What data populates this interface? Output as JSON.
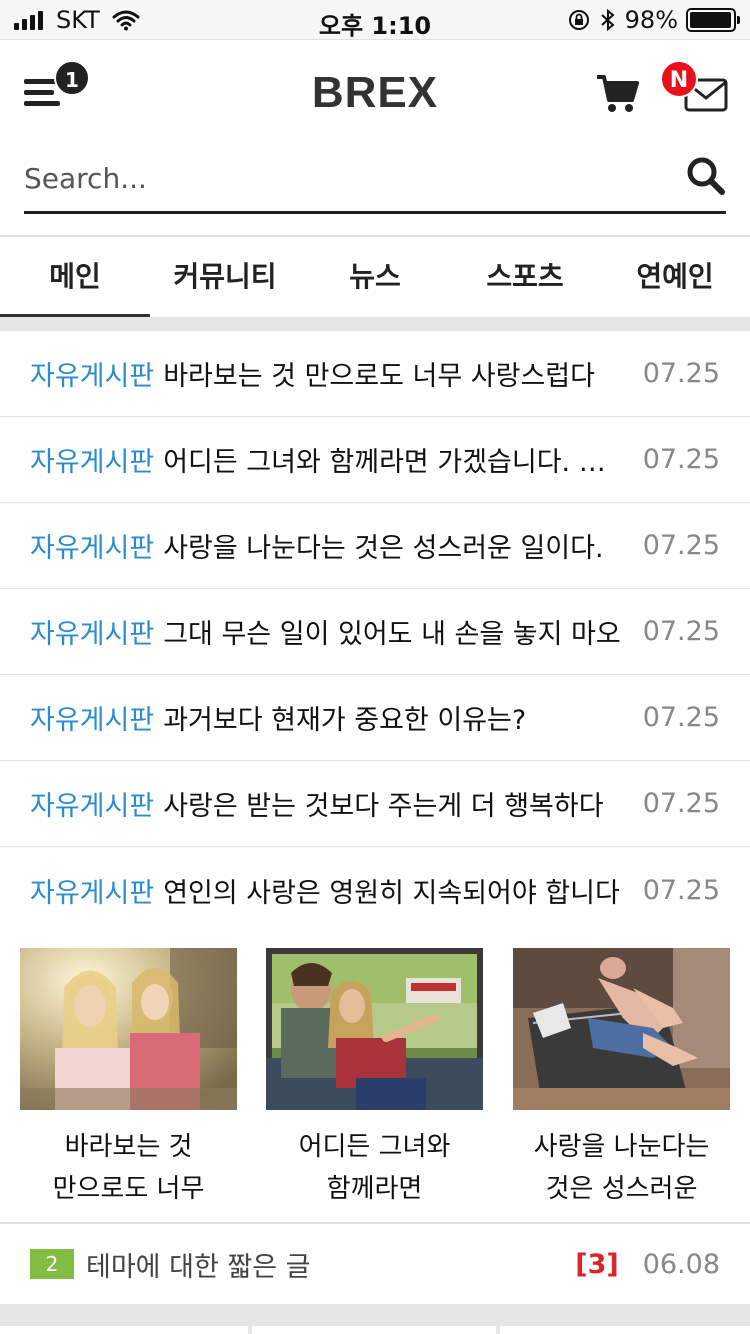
{
  "status_bar": {
    "carrier": "SKT",
    "time": "오후 1:10",
    "battery": "98%",
    "battery_level": 0.98
  },
  "header": {
    "logo": "BREX",
    "menu_badge": "1",
    "mail_badge": "N"
  },
  "search": {
    "placeholder": "Search..."
  },
  "tabs": [
    {
      "label": "메인",
      "active": true
    },
    {
      "label": "커뮤니티"
    },
    {
      "label": "뉴스"
    },
    {
      "label": "스포츠"
    },
    {
      "label": "연예인"
    }
  ],
  "posts": [
    {
      "category": "자유게시판",
      "title": "바라보는 것 만으로도 너무 사랑스럽다",
      "date": "07.25"
    },
    {
      "category": "자유게시판",
      "title": "어디든 그녀와 함께라면 가겠습니다. 어디든",
      "date": "07.25"
    },
    {
      "category": "자유게시판",
      "title": "사랑을 나눈다는 것은 성스러운 일이다.",
      "date": "07.25"
    },
    {
      "category": "자유게시판",
      "title": "그대 무슨 일이 있어도 내 손을 놓지 마오",
      "date": "07.25"
    },
    {
      "category": "자유게시판",
      "title": "과거보다 현재가 중요한 이유는?",
      "date": "07.25"
    },
    {
      "category": "자유게시판",
      "title": "사랑은 받는 것보다 주는게 더 행복하다",
      "date": "07.25"
    },
    {
      "category": "자유게시판",
      "title": "연인의 사랑은 영원히 지속되어야 합니다",
      "date": "07.25"
    }
  ],
  "gallery": [
    {
      "line1": "바라보는 것",
      "line2": "만으로도 너무"
    },
    {
      "line1": "어디든 그녀와",
      "line2": "함께라면"
    },
    {
      "line1": "사랑을 나눈다는",
      "line2": "것은 성스러운"
    }
  ],
  "bottom_post": {
    "rank": "2",
    "title": "테마에 대한 짧은 글",
    "comments": "[3]",
    "date": "06.08"
  },
  "colors": {
    "category": "#2a8ccf",
    "badge_red": "#e8101a",
    "rank_green": "#84bd44",
    "comment_red": "#d9252b"
  }
}
